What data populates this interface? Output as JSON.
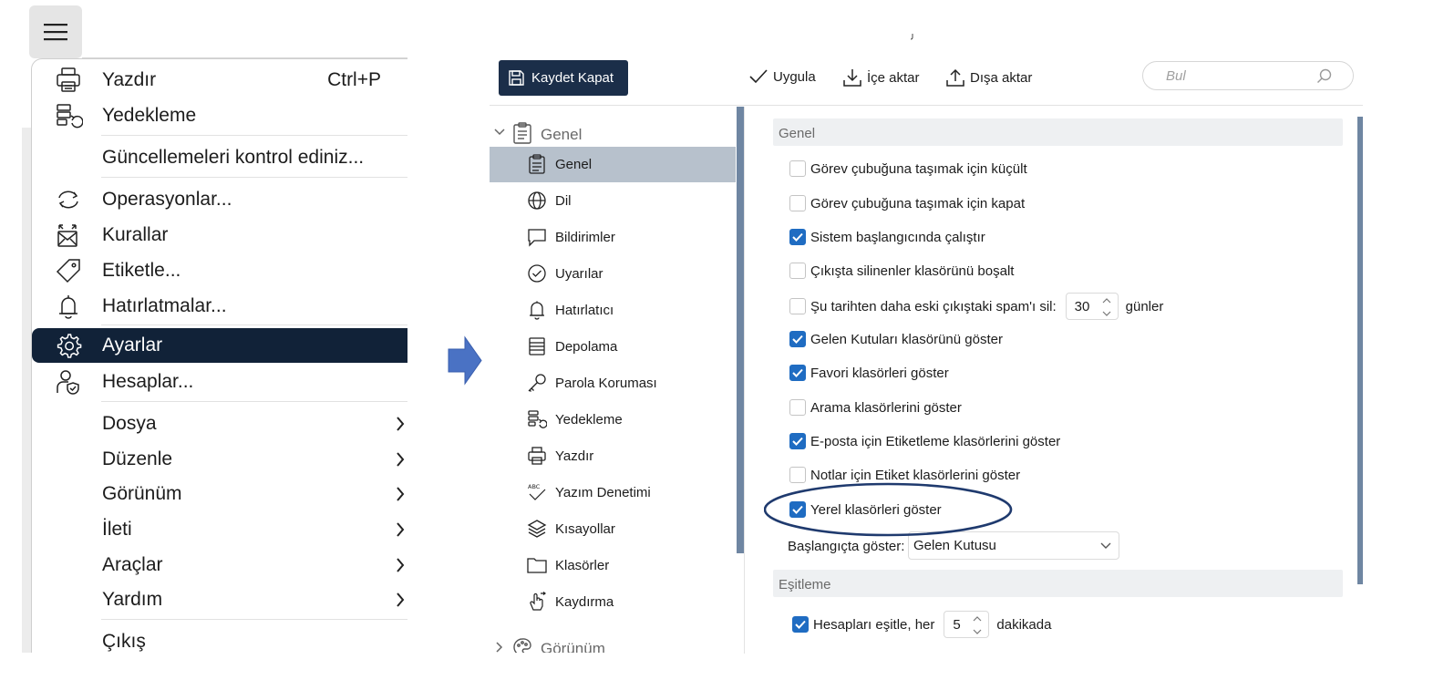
{
  "menu": {
    "items": [
      {
        "label": "Yazdır",
        "shortcut": "Ctrl+P",
        "icon": "printer-icon"
      },
      {
        "label": "Yedekleme",
        "icon": "backup-icon"
      },
      {
        "label": "Güncellemeleri kontrol ediniz...",
        "icon": ""
      },
      {
        "label": "Operasyonlar...",
        "icon": "sync-icon"
      },
      {
        "label": "Kurallar",
        "icon": "rules-icon"
      },
      {
        "label": "Etiketle...",
        "icon": "tag-icon"
      },
      {
        "label": "Hatırlatmalar...",
        "icon": "bell-icon"
      },
      {
        "label": "Ayarlar",
        "icon": "gear-icon",
        "active": true
      },
      {
        "label": "Hesaplar...",
        "icon": "account-shield-icon"
      },
      {
        "label": "Dosya",
        "submenu": true
      },
      {
        "label": "Düzenle",
        "submenu": true
      },
      {
        "label": "Görünüm",
        "submenu": true
      },
      {
        "label": "İleti",
        "submenu": true
      },
      {
        "label": "Araçlar",
        "submenu": true
      },
      {
        "label": "Yardım",
        "submenu": true
      },
      {
        "label": "Çıkış"
      }
    ]
  },
  "toolbar": {
    "save_close": "Kaydet  Kapat",
    "apply": "Uygula",
    "import": "İçe aktar",
    "export": "Dışa aktar",
    "search_placeholder": "Bul"
  },
  "sidebar": {
    "group_general": "Genel",
    "group_view": "Görünüm",
    "items": [
      {
        "label": "Genel",
        "icon": "clipboard-icon",
        "selected": true
      },
      {
        "label": "Dil",
        "icon": "globe-icon"
      },
      {
        "label": "Bildirimler",
        "icon": "speech-bubble-icon"
      },
      {
        "label": "Uyarılar",
        "icon": "check-circle-icon"
      },
      {
        "label": "Hatırlatıcı",
        "icon": "bell-icon"
      },
      {
        "label": "Depolama",
        "icon": "storage-icon"
      },
      {
        "label": "Parola Koruması",
        "icon": "key-icon"
      },
      {
        "label": "Yedekleme",
        "icon": "backup-icon"
      },
      {
        "label": "Yazdır",
        "icon": "printer-icon"
      },
      {
        "label": "Yazım Denetimi",
        "icon": "spellcheck-icon"
      },
      {
        "label": "Kısayollar",
        "icon": "layers-icon"
      },
      {
        "label": "Klasörler",
        "icon": "folder-icon"
      },
      {
        "label": "Kaydırma",
        "icon": "hand-pointer-icon"
      }
    ]
  },
  "settings": {
    "section_general": "Genel",
    "options": [
      {
        "label": "Görev çubuğuna taşımak için küçült",
        "checked": false
      },
      {
        "label": "Görev çubuğuna taşımak için kapat",
        "checked": false
      },
      {
        "label": "Sistem başlangıcında çalıştır",
        "checked": true
      },
      {
        "label": "Çıkışta silinenler klasörünü boşalt",
        "checked": false
      },
      {
        "label": "Şu tarihten daha eski çıkıştaki spam'ı sil:",
        "checked": false,
        "value": "30",
        "unit": "günler"
      },
      {
        "label": "Gelen Kutuları klasörünü göster",
        "checked": true
      },
      {
        "label": "Favori klasörleri göster",
        "checked": true
      },
      {
        "label": "Arama klasörlerini göster",
        "checked": false
      },
      {
        "label": "E-posta için Etiketleme klasörlerini göster",
        "checked": true
      },
      {
        "label": "Notlar için Etiket klasörlerini göster",
        "checked": false
      },
      {
        "label": "Yerel klasörleri göster",
        "checked": true
      }
    ],
    "startup_label": "Başlangıçta göster:",
    "startup_value": "Gelen Kutusu",
    "section_sync": "Eşitleme",
    "sync_label": "Hesapları eşitle, her",
    "sync_value": "5",
    "sync_unit": "dakikada"
  },
  "colors": {
    "active_menu": "#112238",
    "save_button": "#1b2e49",
    "checkbox": "#1f6cc2",
    "sidebar_selected": "#b7c1cc",
    "highlight_ellipse": "#1f3a6e",
    "arrow": "#4a72c4"
  }
}
